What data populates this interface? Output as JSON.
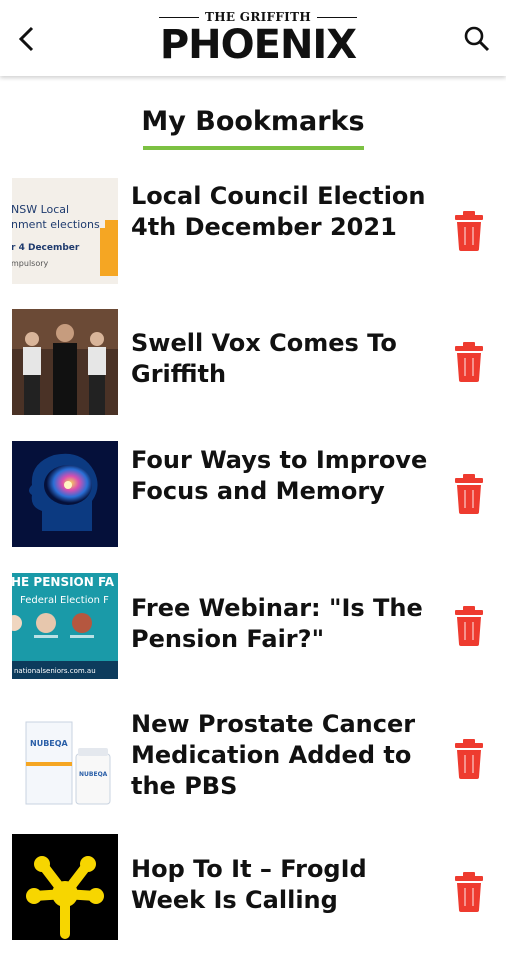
{
  "header": {
    "logo_top": "THE GRIFFITH",
    "logo_main": "PHOENIX"
  },
  "page": {
    "title": "My Bookmarks"
  },
  "colors": {
    "accent_green": "#7cc142",
    "trash_red": "#ee3b2f"
  },
  "icons": {
    "back": "chevron-left-icon",
    "search": "search-icon",
    "delete": "trash-icon"
  },
  "thumb_texts": {
    "nsw_line1": "NSW Local",
    "nsw_line2": "nment elections",
    "nsw_line3": "r 4 December",
    "nsw_line4": "mpulsory",
    "pension_banner": "HE PENSION FA",
    "pension_sub": "Federal Election F",
    "pension_url": "nationalseniors.com.au",
    "med_box1": "NUBEQA",
    "med_box2": "NUBEQA"
  },
  "bookmarks": [
    {
      "title": "Local Council Election 4th December 2021"
    },
    {
      "title": "Swell Vox Comes To Griffith"
    },
    {
      "title": "Four Ways to Improve Focus and Memory"
    },
    {
      "title": "Free Webinar: \"Is The Pension Fair?\""
    },
    {
      "title": "New Prostate Cancer Medication Added to the PBS"
    },
    {
      "title": "Hop To It – FrogId Week Is Calling"
    }
  ]
}
